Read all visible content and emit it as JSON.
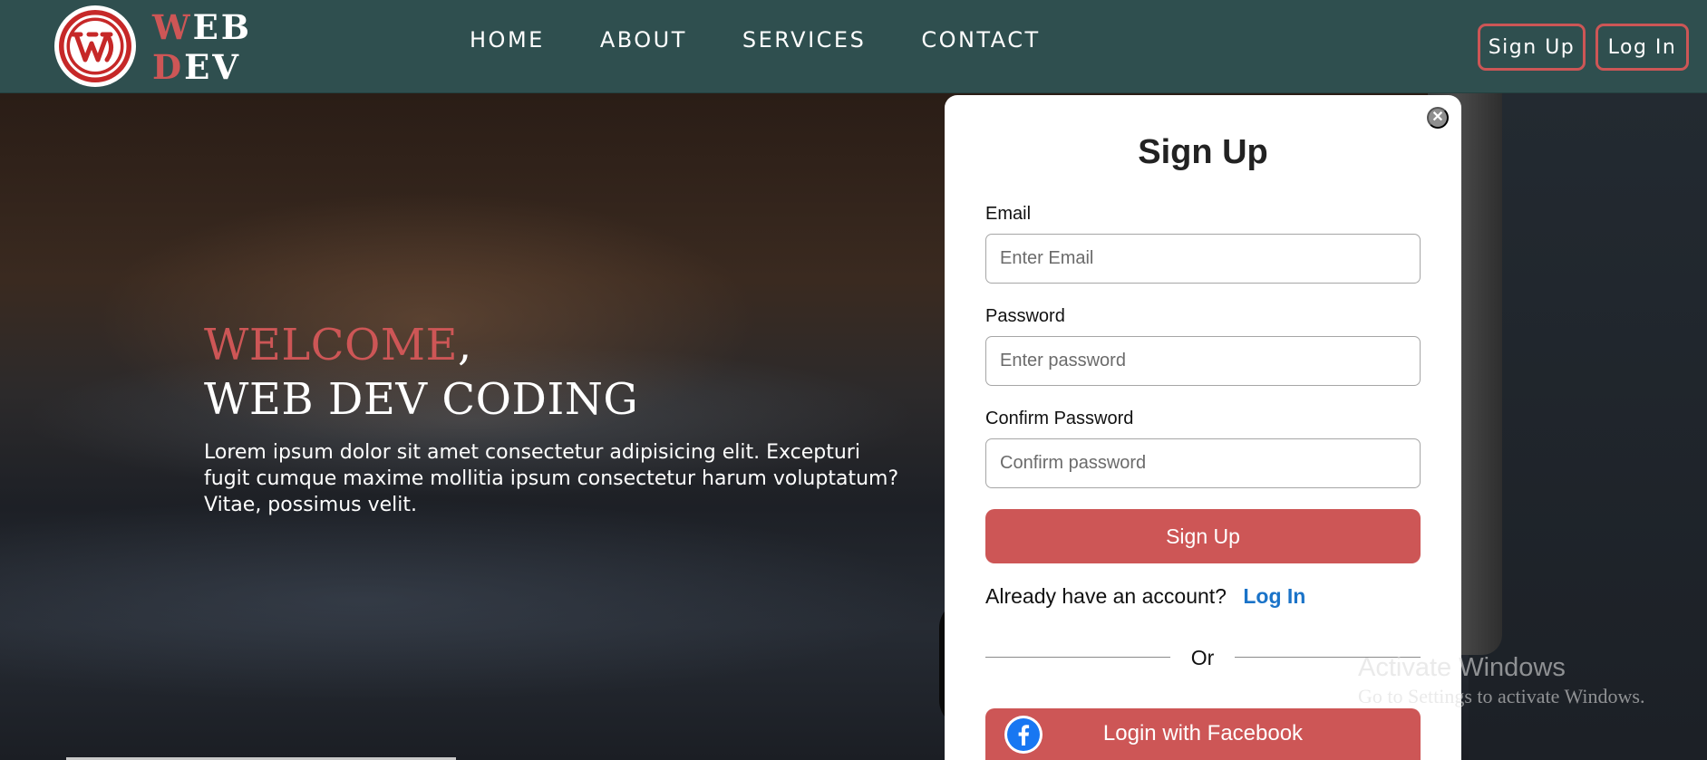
{
  "header": {
    "brand": {
      "line1_accent": "W",
      "line1_rest": "EB",
      "line2_accent": "D",
      "line2_rest": "EV"
    },
    "nav": [
      "HOME",
      "ABOUT",
      "SERVICES",
      "CONTACT"
    ],
    "signup_label": "Sign Up",
    "login_label": "Log In"
  },
  "hero": {
    "welcome": "WELCOME",
    "comma": ",",
    "subtitle": "WEB DEV CODING",
    "body": "Lorem ipsum dolor sit amet consectetur adipisicing elit. Excepturi fugit cumque maxime mollitia ipsum consectetur harum voluptatum? Vitae, possimus velit."
  },
  "modal": {
    "title": "Sign Up",
    "close_glyph": "✕",
    "fields": [
      {
        "label": "Email",
        "placeholder": "Enter Email"
      },
      {
        "label": "Password",
        "placeholder": "Enter password"
      },
      {
        "label": "Confirm Password",
        "placeholder": "Confirm password"
      }
    ],
    "submit_label": "Sign Up",
    "have_account": "Already have an account?",
    "login_link": "Log In",
    "or": "Or",
    "facebook_label": "Login with Facebook"
  },
  "watermark": {
    "title": "Activate Windows",
    "subtitle": "Go to Settings to activate Windows."
  },
  "colors": {
    "header_bg": "#2f4f4f",
    "accent": "#cd5656",
    "link": "#1a73c8",
    "facebook_blue": "#1877f2"
  },
  "icons": [
    "wordpress-logo-icon",
    "close-icon",
    "facebook-icon"
  ]
}
